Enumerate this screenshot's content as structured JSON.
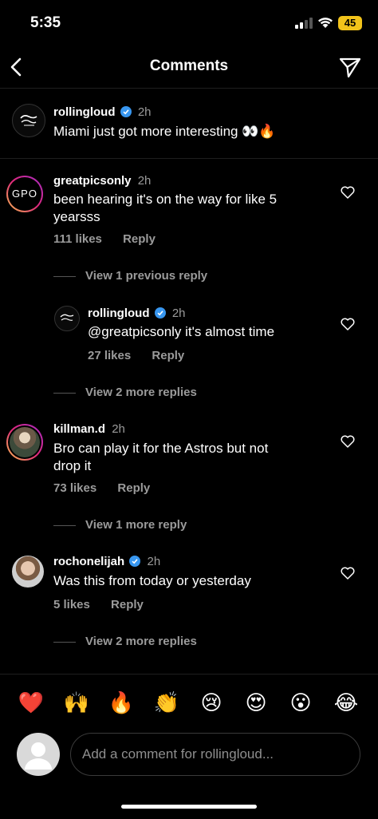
{
  "status": {
    "time": "5:35",
    "battery": "45"
  },
  "nav": {
    "title": "Comments"
  },
  "caption": {
    "username": "rollingloud",
    "time": "2h",
    "text": "Miami just got more interesting 👀🔥"
  },
  "comments": [
    {
      "username": "greatpicsonly",
      "time": "2h",
      "text_line1": "been hearing it's on the way for like 5",
      "text_line2": "yearsss",
      "likes": "111 likes",
      "reply": "Reply",
      "avatar_text": "GPO",
      "view_more": "View 1 previous reply"
    },
    {
      "username": "rollingloud",
      "time": "2h",
      "text": "@greatpicsonly it's almost time",
      "likes": "27 likes",
      "reply": "Reply",
      "view_more": "View 2 more replies"
    },
    {
      "username": "killman.d",
      "time": "2h",
      "text_line1": "Bro can play it for the Astros but not",
      "text_line2": "drop it",
      "likes": "73 likes",
      "reply": "Reply",
      "view_more": "View 1 more reply"
    },
    {
      "username": "rochonelijah",
      "time": "2h",
      "text": "Was this from today or yesterday",
      "likes": "5 likes",
      "reply": "Reply",
      "view_more": "View 2 more replies"
    }
  ],
  "emojis": [
    "❤️",
    "🙌",
    "🔥",
    "👏",
    "😢",
    "😍",
    "😮",
    "😂"
  ],
  "composer": {
    "placeholder": "Add a comment for rollingloud..."
  },
  "colors": {
    "verified": "#3897f0",
    "muted": "#9b9b9b"
  }
}
